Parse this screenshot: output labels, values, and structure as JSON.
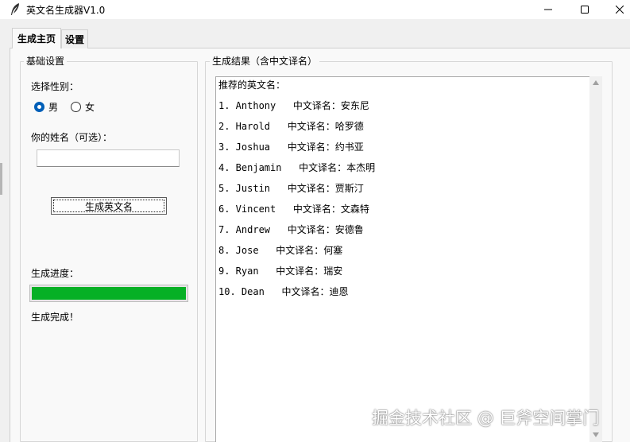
{
  "window": {
    "title": "英文名生成器V1.0",
    "icon": "feather-icon",
    "controls": [
      "minimize-icon",
      "maximize-icon",
      "close-icon"
    ]
  },
  "tabs": [
    {
      "label": "生成主页",
      "active": true
    },
    {
      "label": "设置",
      "active": false
    }
  ],
  "left_panel": {
    "title": "基础设置",
    "gender_label": "选择性别：",
    "gender_options": [
      {
        "label": "男",
        "selected": true
      },
      {
        "label": "女",
        "selected": false
      }
    ],
    "name_label": "你的姓名（可选）：",
    "name_value": "",
    "generate_button": "生成英文名",
    "progress_label": "生成进度：",
    "progress_percent": 100,
    "status_text": "生成完成！"
  },
  "right_panel": {
    "title": "生成结果（含中文译名）",
    "header_line": "推荐的英文名：",
    "results": [
      "1. Anthony   中文译名：安东尼",
      "2. Harold   中文译名：哈罗德",
      "3. Joshua   中文译名：约书亚",
      "4. Benjamin   中文译名：本杰明",
      "5. Justin   中文译名：贾斯汀",
      "6. Vincent   中文译名：文森特",
      "7. Andrew   中文译名：安德鲁",
      "8. Jose   中文译名：何塞",
      "9. Ryan   中文译名：瑞安",
      "10. Dean   中文译名：迪恩"
    ]
  },
  "watermark": "掘金技术社区 @ 巨斧空间掌门",
  "colors": {
    "accent": "#005fb8",
    "progress": "#06b025",
    "window_bg": "#f0f0f0"
  }
}
